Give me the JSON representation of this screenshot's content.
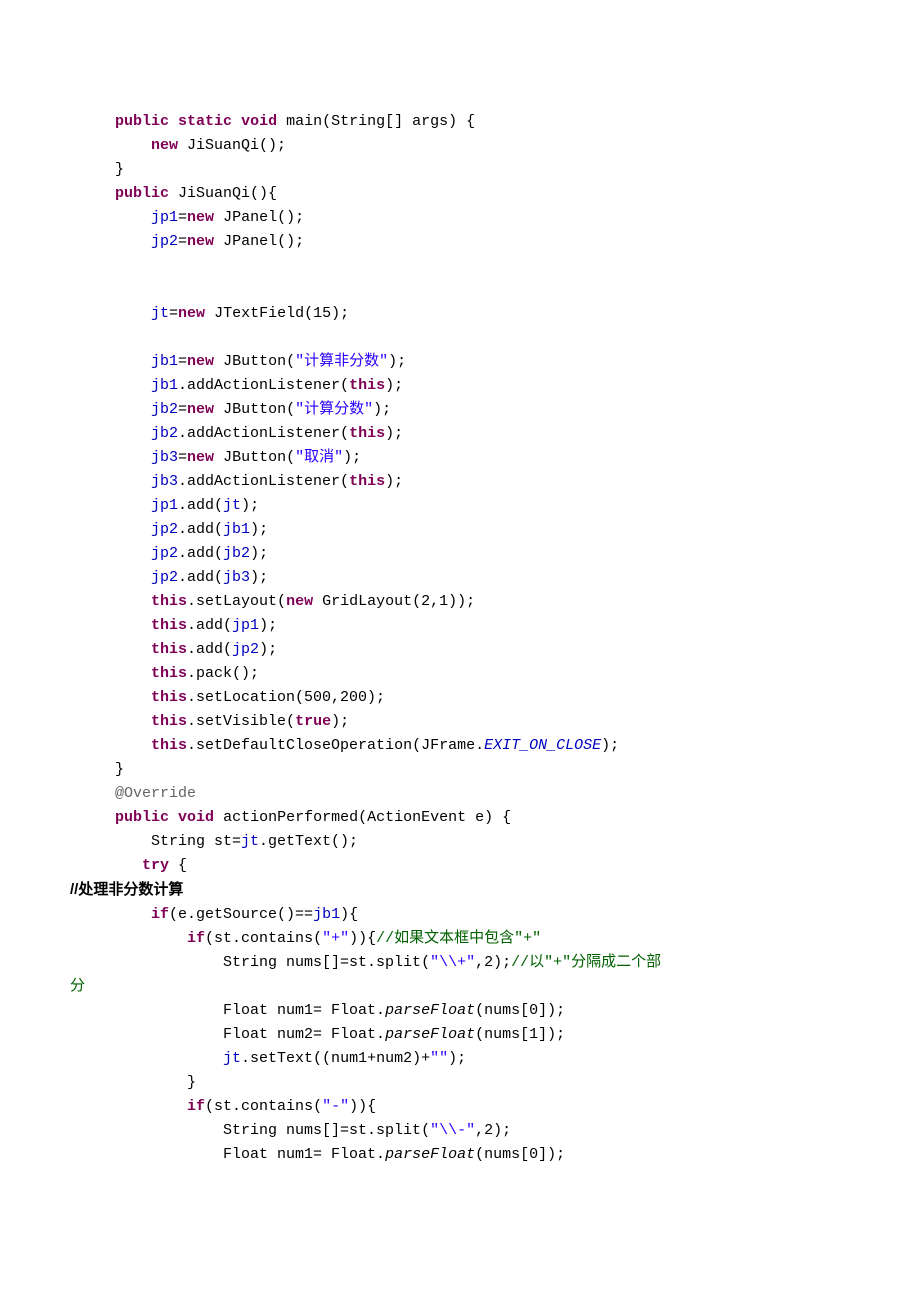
{
  "code": {
    "indent1": "     ",
    "indent2": "         ",
    "indent3": "             ",
    "indent4": "                 ",
    "line1_a": "public",
    "line1_b": "static",
    "line1_c": "void",
    "line1_d": " main(String[] args) {",
    "line2_a": "new",
    "line2_b": " JiSuanQi();",
    "line3": "}",
    "line4_a": "public",
    "line4_b": " JiSuanQi(){",
    "line5_a": "jp1",
    "line5_b": "=",
    "line5_c": "new",
    "line5_d": " JPanel();",
    "line6_a": "jp2",
    "line6_b": "=",
    "line6_c": "new",
    "line6_d": " JPanel();",
    "line7_a": "jt",
    "line7_b": "=",
    "line7_c": "new",
    "line7_d": " JTextField(15);",
    "line8_a": "jb1",
    "line8_b": "=",
    "line8_c": "new",
    "line8_d": " JButton(",
    "line8_e": "\"计算非分数\"",
    "line8_f": ");",
    "line9_a": "jb1",
    "line9_b": ".addActionListener(",
    "line9_c": "this",
    "line9_d": ");",
    "line10_a": "jb2",
    "line10_b": "=",
    "line10_c": "new",
    "line10_d": " JButton(",
    "line10_e": "\"计算分数\"",
    "line10_f": ");",
    "line11_a": "jb2",
    "line11_b": ".addActionListener(",
    "line11_c": "this",
    "line11_d": ");",
    "line12_a": "jb3",
    "line12_b": "=",
    "line12_c": "new",
    "line12_d": " JButton(",
    "line12_e": "\"取消\"",
    "line12_f": ");",
    "line13_a": "jb3",
    "line13_b": ".addActionListener(",
    "line13_c": "this",
    "line13_d": ");",
    "line14_a": "jp1",
    "line14_b": ".add(",
    "line14_c": "jt",
    "line14_d": ");",
    "line15_a": "jp2",
    "line15_b": ".add(",
    "line15_c": "jb1",
    "line15_d": ");",
    "line16_a": "jp2",
    "line16_b": ".add(",
    "line16_c": "jb2",
    "line16_d": ");",
    "line17_a": "jp2",
    "line17_b": ".add(",
    "line17_c": "jb3",
    "line17_d": ");",
    "line18_a": "this",
    "line18_b": ".setLayout(",
    "line18_c": "new",
    "line18_d": " GridLayout(2,1));",
    "line19_a": "this",
    "line19_b": ".add(",
    "line19_c": "jp1",
    "line19_d": ");",
    "line20_a": "this",
    "line20_b": ".add(",
    "line20_c": "jp2",
    "line20_d": ");",
    "line21_a": "this",
    "line21_b": ".pack();",
    "line22_a": "this",
    "line22_b": ".setLocation(500,200);",
    "line23_a": "this",
    "line23_b": ".setVisible(",
    "line23_c": "true",
    "line23_d": ");",
    "line24_a": "this",
    "line24_b": ".setDefaultCloseOperation(JFrame.",
    "line24_c": "EXIT_ON_CLOSE",
    "line24_d": ");",
    "line25": "}",
    "line26": "@Override",
    "line27_a": "public",
    "line27_b": "void",
    "line27_c": " actionPerformed(ActionEvent e) {",
    "line28_a": "String st=",
    "line28_b": "jt",
    "line28_c": ".getText();",
    "line29_a": "try",
    "line29_b": " {",
    "heading": "//处理非分数计算",
    "line30_a": "if",
    "line30_b": "(e.getSource()==",
    "line30_c": "jb1",
    "line30_d": "){",
    "line31_a": "if",
    "line31_b": "(st.contains(",
    "line31_c": "\"+\"",
    "line31_d": ")){",
    "line31_e": "//如果文本框中包含\"+\"",
    "line32_a": "String nums[]=st.split(",
    "line32_b": "\"\\\\+\"",
    "line32_c": ",2);",
    "line32_d": "//以\"+\"分隔成二个部",
    "line32_e": "分",
    "line33_a": "Float num1= Float.",
    "line33_b": "parseFloat",
    "line33_c": "(nums[0]);",
    "line34_a": "Float num2= Float.",
    "line34_b": "parseFloat",
    "line34_c": "(nums[1]);",
    "line35_a": "jt",
    "line35_b": ".setText((num1+num2)+",
    "line35_c": "\"\"",
    "line35_d": ");",
    "line36": "}",
    "line37_a": "if",
    "line37_b": "(st.contains(",
    "line37_c": "\"-\"",
    "line37_d": ")){",
    "line38_a": "String nums[]=st.split(",
    "line38_b": "\"\\\\-\"",
    "line38_c": ",2);",
    "line39_a": "Float num1= Float.",
    "line39_b": "parseFloat",
    "line39_c": "(nums[0]);",
    "margin0": "",
    "margin_class": "     ",
    "margin_method": "         "
  }
}
